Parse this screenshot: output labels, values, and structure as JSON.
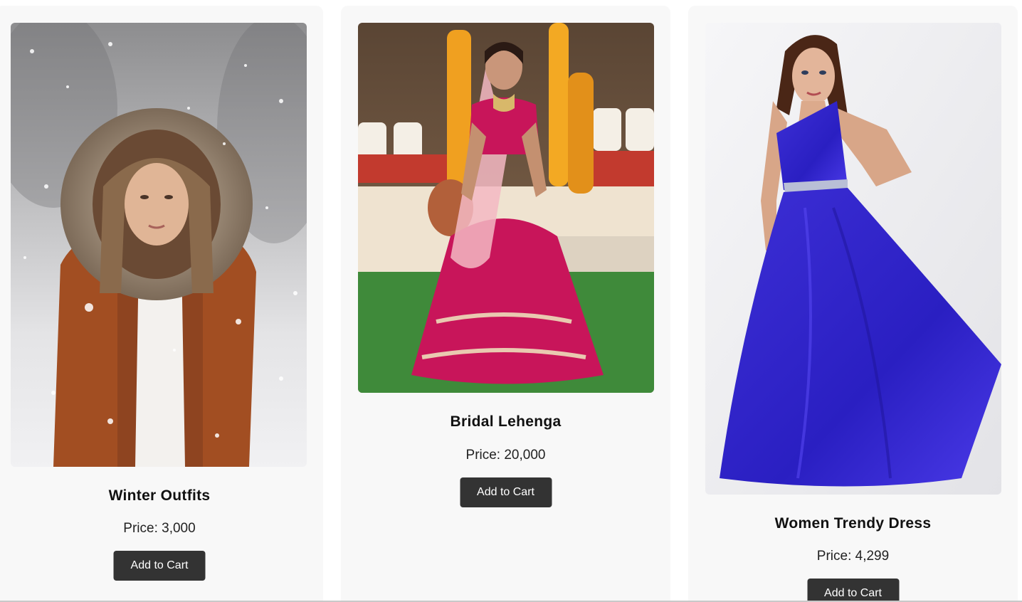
{
  "products": [
    {
      "name": "Winter Outfits",
      "price": "Price: 3,000",
      "button_label": "Add to Cart",
      "image_alt": "Woman in fur-hooded rust coat in snow"
    },
    {
      "name": "Bridal Lehenga",
      "price": "Price: 20,000",
      "button_label": "Add to Cart",
      "image_alt": "Bride in pink embroidered lehenga"
    },
    {
      "name": "Women Trendy Dress",
      "price": "Price: 4,299",
      "button_label": "Add to Cart",
      "image_alt": "Woman in blue one-shoulder gown"
    }
  ],
  "colors": {
    "card_background": "#f8f8f8",
    "button_background": "#333333",
    "button_text": "#ffffff"
  }
}
